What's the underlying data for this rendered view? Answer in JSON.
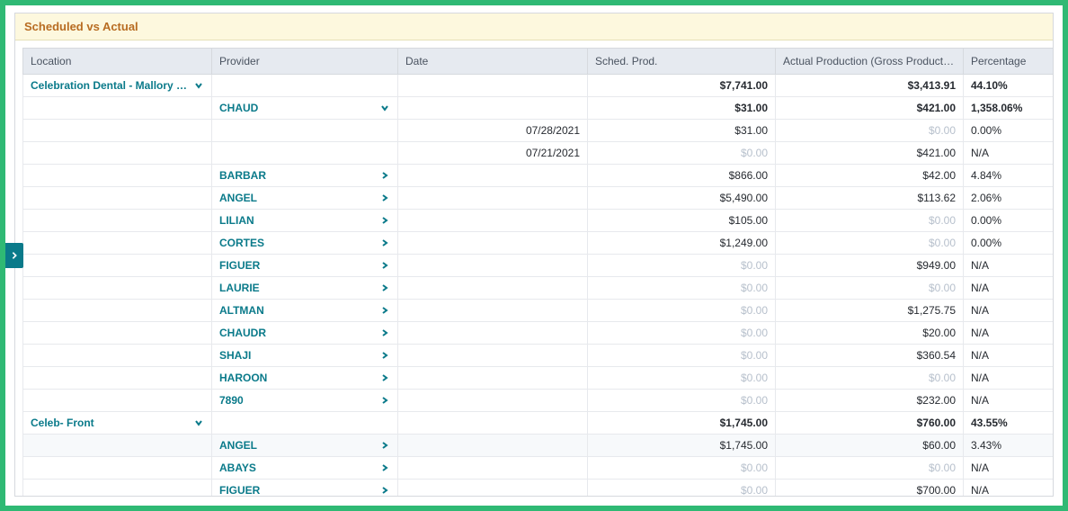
{
  "title": "Scheduled vs Actual",
  "columns": {
    "location": "Location",
    "provider": "Provider",
    "date": "Date",
    "sched_prod": "Sched. Prod.",
    "actual_prod": "Actual Production (Gross Production (DO…",
    "percentage": "Percentage"
  },
  "rows": [
    {
      "type": "loc",
      "location": "Celebration Dental - Mallory Circle",
      "sched": "$7,741.00",
      "actual": "$3,413.91",
      "pct": "44.10%",
      "bold": true,
      "expand": "down"
    },
    {
      "type": "prov",
      "provider": "CHAUD",
      "sched": "$31.00",
      "actual": "$421.00",
      "pct": "1,358.06%",
      "bold": true,
      "expand": "down"
    },
    {
      "type": "date",
      "date": "07/28/2021",
      "sched": "$31.00",
      "sched_muted": false,
      "actual": "$0.00",
      "actual_muted": true,
      "pct": "0.00%"
    },
    {
      "type": "date",
      "date": "07/21/2021",
      "sched": "$0.00",
      "sched_muted": true,
      "actual": "$421.00",
      "actual_muted": false,
      "pct": "N/A"
    },
    {
      "type": "prov",
      "provider": "BARBAR",
      "sched": "$866.00",
      "actual": "$42.00",
      "pct": "4.84%",
      "expand": "right"
    },
    {
      "type": "prov",
      "provider": "ANGEL",
      "sched": "$5,490.00",
      "actual": "$113.62",
      "pct": "2.06%",
      "expand": "right"
    },
    {
      "type": "prov",
      "provider": "LILIAN",
      "sched": "$105.00",
      "actual": "$0.00",
      "actual_muted": true,
      "pct": "0.00%",
      "expand": "right"
    },
    {
      "type": "prov",
      "provider": "CORTES",
      "sched": "$1,249.00",
      "actual": "$0.00",
      "actual_muted": true,
      "pct": "0.00%",
      "expand": "right"
    },
    {
      "type": "prov",
      "provider": "FIGUER",
      "sched": "$0.00",
      "sched_muted": true,
      "actual": "$949.00",
      "pct": "N/A",
      "expand": "right"
    },
    {
      "type": "prov",
      "provider": "LAURIE",
      "sched": "$0.00",
      "sched_muted": true,
      "actual": "$0.00",
      "actual_muted": true,
      "pct": "N/A",
      "expand": "right"
    },
    {
      "type": "prov",
      "provider": "ALTMAN",
      "sched": "$0.00",
      "sched_muted": true,
      "actual": "$1,275.75",
      "pct": "N/A",
      "expand": "right"
    },
    {
      "type": "prov",
      "provider": "CHAUDR",
      "sched": "$0.00",
      "sched_muted": true,
      "actual": "$20.00",
      "pct": "N/A",
      "expand": "right"
    },
    {
      "type": "prov",
      "provider": "SHAJI",
      "sched": "$0.00",
      "sched_muted": true,
      "actual": "$360.54",
      "pct": "N/A",
      "expand": "right"
    },
    {
      "type": "prov",
      "provider": "HAROON",
      "sched": "$0.00",
      "sched_muted": true,
      "actual": "$0.00",
      "actual_muted": true,
      "pct": "N/A",
      "expand": "right"
    },
    {
      "type": "prov",
      "provider": "7890",
      "sched": "$0.00",
      "sched_muted": true,
      "actual": "$232.00",
      "pct": "N/A",
      "expand": "right"
    },
    {
      "type": "loc",
      "location": "Celeb- Front",
      "sched": "$1,745.00",
      "actual": "$760.00",
      "pct": "43.55%",
      "bold": true,
      "expand": "down"
    },
    {
      "type": "prov",
      "provider": "ANGEL",
      "sched": "$1,745.00",
      "actual": "$60.00",
      "pct": "3.43%",
      "expand": "right",
      "zebra": true
    },
    {
      "type": "prov",
      "provider": "ABAYS",
      "sched": "$0.00",
      "sched_muted": true,
      "actual": "$0.00",
      "actual_muted": true,
      "pct": "N/A",
      "expand": "right"
    },
    {
      "type": "prov",
      "provider": "FIGUER",
      "sched": "$0.00",
      "sched_muted": true,
      "actual": "$700.00",
      "pct": "N/A",
      "expand": "right"
    }
  ]
}
